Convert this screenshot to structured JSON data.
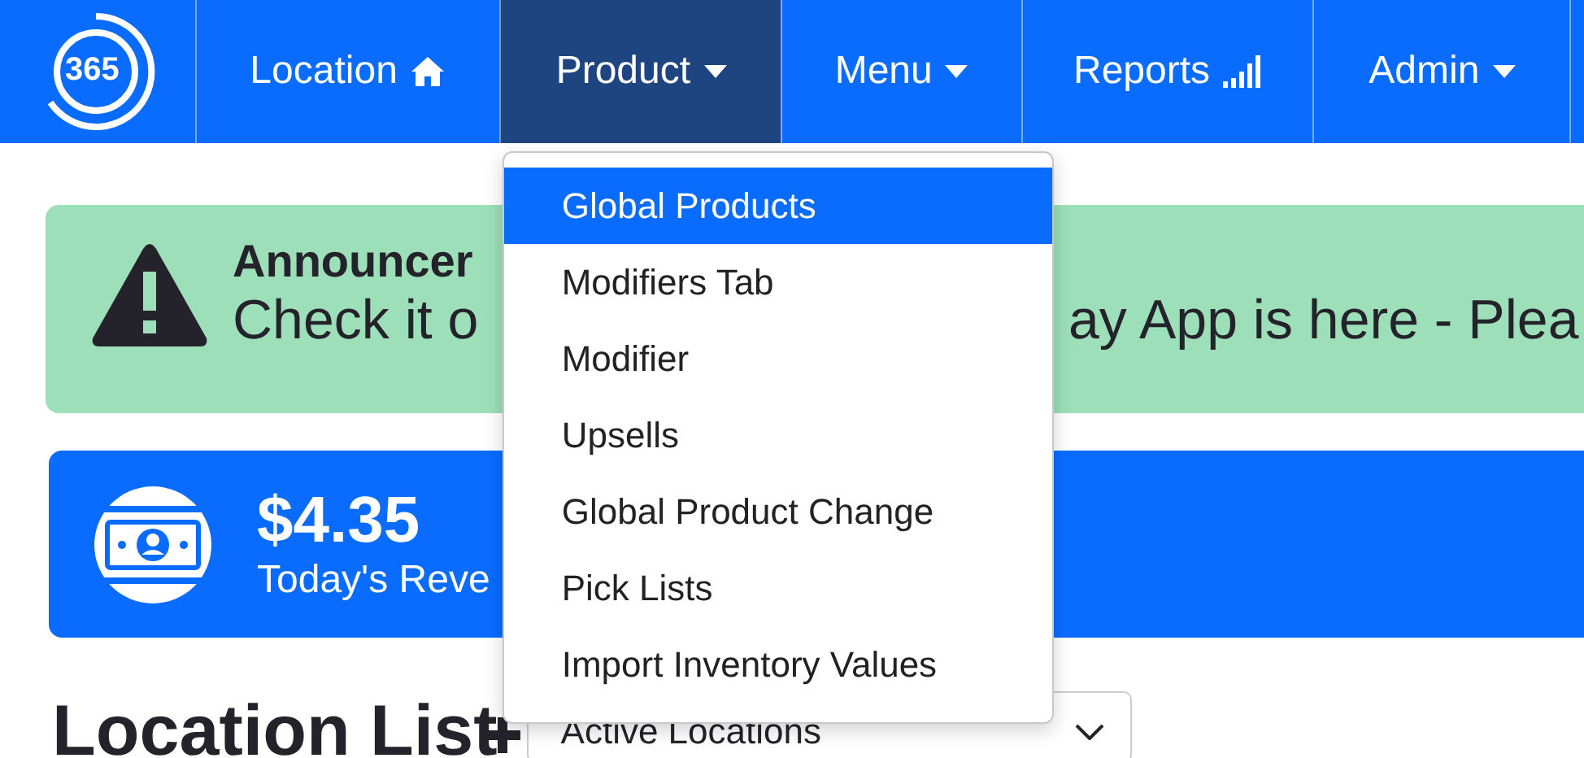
{
  "nav": {
    "logo": "365",
    "items": [
      {
        "label": "Location",
        "kind": "home",
        "dropdown": false,
        "selected": false
      },
      {
        "label": "Product",
        "kind": "plain",
        "dropdown": true,
        "selected": true
      },
      {
        "label": "Menu",
        "kind": "plain",
        "dropdown": true,
        "selected": false
      },
      {
        "label": "Reports",
        "kind": "signal",
        "dropdown": false,
        "selected": false
      },
      {
        "label": "Admin",
        "kind": "plain",
        "dropdown": true,
        "selected": false
      }
    ]
  },
  "product_menu": {
    "items": [
      {
        "label": "Global Products",
        "selected": true
      },
      {
        "label": "Modifiers Tab",
        "selected": false
      },
      {
        "label": "Modifier",
        "selected": false
      },
      {
        "label": "Upsells",
        "selected": false
      },
      {
        "label": "Global Product Change",
        "selected": false
      },
      {
        "label": "Pick Lists",
        "selected": false
      },
      {
        "label": "Import Inventory Values",
        "selected": false
      }
    ]
  },
  "announcement": {
    "title": "Announcer",
    "message_parts": [
      "Check it o",
      "ay App is here - Plea"
    ]
  },
  "revenue": {
    "amount": "$4.35",
    "label": "Today's Reve"
  },
  "location_list": {
    "heading": "Location List",
    "filter": {
      "value": "Active Locations"
    }
  }
}
